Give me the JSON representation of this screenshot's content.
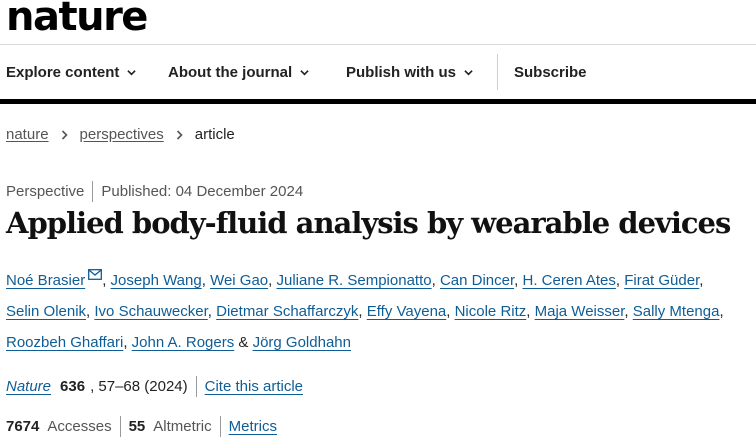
{
  "header": {
    "logo": "nature",
    "nav": [
      {
        "label": "Explore content"
      },
      {
        "label": "About the journal"
      },
      {
        "label": "Publish with us"
      }
    ],
    "subscribe": "Subscribe"
  },
  "breadcrumbs": [
    "nature",
    "perspectives",
    "article"
  ],
  "article": {
    "type": "Perspective",
    "published": "Published: 04 December 2024",
    "title": "Applied body-fluid analysis by wearable devices",
    "authors": [
      "Noé Brasier",
      "Joseph Wang",
      "Wei Gao",
      "Juliane R. Sempionatto",
      "Can Dincer",
      "H. Ceren Ates",
      "Firat Güder",
      "Selin Olenik",
      "Ivo Schauwecker",
      "Dietmar Schaffarczyk",
      "Effy Vayena",
      "Nicole Ritz",
      "Maja Weisser",
      "Sally Mtenga",
      "Roozbeh Ghaffari",
      "John A. Rogers",
      "Jörg Goldhahn"
    ],
    "and_sep": "&",
    "comma": ",",
    "journal": "Nature",
    "volume": "636",
    "pages": ", 57–68 (2024)",
    "cite": "Cite this article",
    "accesses_count": "7674",
    "accesses_label": "Accesses",
    "altmetric_count": "55",
    "altmetric_label": "Altmetric",
    "metrics_link": "Metrics"
  },
  "icons": {
    "mail": "mail-icon",
    "chevron": "chevron-down-icon",
    "breadcrumb_sep": "chevron-right-icon"
  },
  "colors": {
    "link": "#0e5d96",
    "nav_bar": "#000000"
  }
}
